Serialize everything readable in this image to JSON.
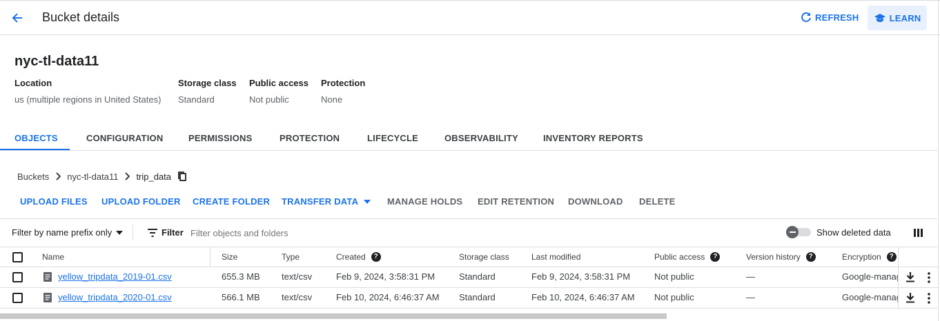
{
  "header": {
    "title": "Bucket details",
    "refresh_label": "REFRESH",
    "learn_label": "LEARN"
  },
  "bucket": {
    "name": "nyc-tl-data11",
    "fields": [
      {
        "label": "Location",
        "value": "us (multiple regions in United States)"
      },
      {
        "label": "Storage class",
        "value": "Standard"
      },
      {
        "label": "Public access",
        "value": "Not public"
      },
      {
        "label": "Protection",
        "value": "None"
      }
    ]
  },
  "tabs": [
    {
      "label": "OBJECTS",
      "active": true
    },
    {
      "label": "CONFIGURATION"
    },
    {
      "label": "PERMISSIONS"
    },
    {
      "label": "PROTECTION"
    },
    {
      "label": "LIFECYCLE"
    },
    {
      "label": "OBSERVABILITY"
    },
    {
      "label": "INVENTORY REPORTS"
    }
  ],
  "breadcrumb": [
    "Buckets",
    "nyc-tl-data11",
    "trip_data"
  ],
  "actions": {
    "upload_files": "UPLOAD FILES",
    "upload_folder": "UPLOAD FOLDER",
    "create_folder": "CREATE FOLDER",
    "transfer_data": "TRANSFER DATA",
    "manage_holds": "MANAGE HOLDS",
    "edit_retention": "EDIT RETENTION",
    "download": "DOWNLOAD",
    "delete": "DELETE"
  },
  "filter": {
    "mode": "Filter by name prefix only",
    "label": "Filter",
    "placeholder": "Filter objects and folders",
    "show_deleted": "Show deleted data",
    "show_deleted_on": false
  },
  "table": {
    "columns": [
      "Name",
      "Size",
      "Type",
      "Created",
      "Storage class",
      "Last modified",
      "Public access",
      "Version history",
      "Encryption"
    ],
    "rows": [
      {
        "name": "yellow_tripdata_2019-01.csv",
        "size": "655.3 MB",
        "type": "text/csv",
        "created": "Feb 9, 2024, 3:58:31 PM",
        "storage_class": "Standard",
        "last_modified": "Feb 9, 2024, 3:58:31 PM",
        "public_access": "Not public",
        "version_history": "—",
        "encryption": "Google-managed"
      },
      {
        "name": "yellow_tripdata_2020-01.csv",
        "size": "566.1 MB",
        "type": "text/csv",
        "created": "Feb 10, 2024, 6:46:37 AM",
        "storage_class": "Standard",
        "last_modified": "Feb 10, 2024, 6:46:37 AM",
        "public_access": "Not public",
        "version_history": "—",
        "encryption": "Google-managed"
      }
    ]
  },
  "icons": {
    "back": "arrow-left-icon",
    "refresh": "refresh-icon",
    "learn": "school-icon",
    "copy": "copy-icon",
    "filter": "filter-icon",
    "columns": "column-display-icon",
    "download": "download-icon",
    "more": "more-vert-icon"
  },
  "colors": {
    "accent": "#1a73e8",
    "divider": "#dadce0",
    "text": "#202124"
  }
}
